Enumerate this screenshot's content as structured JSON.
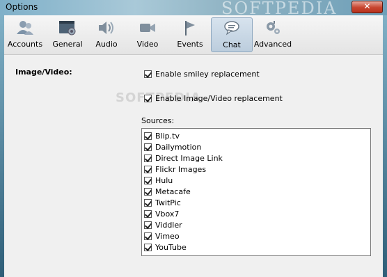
{
  "window": {
    "title": "Options",
    "close_label": "✕",
    "watermark": "SOFTPEDIA"
  },
  "toolbar": {
    "items": [
      {
        "label": "Accounts",
        "icon": "accounts-icon"
      },
      {
        "label": "General",
        "icon": "general-icon"
      },
      {
        "label": "Audio",
        "icon": "audio-icon"
      },
      {
        "label": "Video",
        "icon": "video-icon"
      },
      {
        "label": "Events",
        "icon": "events-icon"
      },
      {
        "label": "Chat",
        "icon": "chat-icon",
        "active": true
      },
      {
        "label": "Advanced",
        "icon": "advanced-icon"
      }
    ]
  },
  "content": {
    "section_label": "Image/Video:",
    "smiley": {
      "label": "Enable smiley replacement",
      "checked": true
    },
    "image_video": {
      "label": "Enable Image/Video replacement",
      "checked": true
    },
    "sources_label": "Sources:",
    "sources": [
      {
        "label": "Blip.tv",
        "checked": true
      },
      {
        "label": "Dailymotion",
        "checked": true
      },
      {
        "label": "Direct Image Link",
        "checked": true
      },
      {
        "label": "Flickr Images",
        "checked": true
      },
      {
        "label": "Hulu",
        "checked": true
      },
      {
        "label": "Metacafe",
        "checked": true
      },
      {
        "label": "TwitPic",
        "checked": true
      },
      {
        "label": "Vbox7",
        "checked": true
      },
      {
        "label": "Viddler",
        "checked": true
      },
      {
        "label": "Vimeo",
        "checked": true
      },
      {
        "label": "YouTube",
        "checked": true
      }
    ]
  },
  "colors": {
    "accent": "#8ea8c0",
    "close": "#c7452f"
  }
}
